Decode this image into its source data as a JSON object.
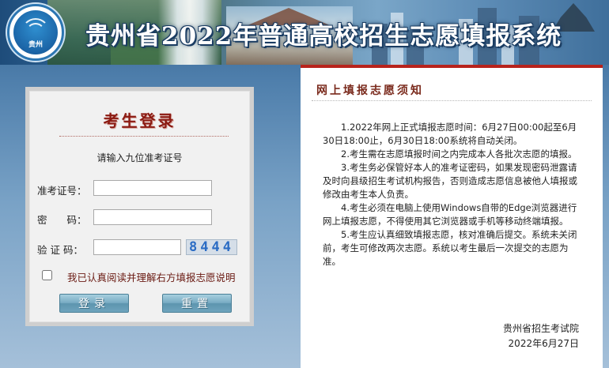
{
  "header": {
    "logo_text": "贵州",
    "title": "贵州省2022年普通高校招生志愿填报系统"
  },
  "login": {
    "title": "考生登录",
    "hint": "请输入九位准考证号",
    "fields": {
      "exam_id_label": "准考证号：",
      "exam_id_value": "",
      "password_label": "密　　码：",
      "password_value": "",
      "captcha_label": "验 证 码：",
      "captcha_value": "",
      "captcha_code": "8444"
    },
    "agree_label": "我已认真阅读并理解右方填报志愿说明",
    "agree_checked": false,
    "login_button": "登录",
    "reset_button": "重置"
  },
  "notice": {
    "title": "网上填报志愿须知",
    "items": [
      "1.2022年网上正式填报志愿时间：6月27日00:00起至6月30日18:00止，6月30日18:00系统将自动关闭。",
      "2.考生需在志愿填报时间之内完成本人各批次志愿的填报。",
      "3.考生务必保管好本人的准考证密码，如果发现密码泄露请及时向县级招生考试机构报告，否则造成志愿信息被他人填报或修改由考生本人负责。",
      "4.考生必须在电脑上使用Windows自带的Edge浏览器进行网上填报志愿，不得使用其它浏览器或手机等移动终端填报。",
      "5.考生应认真细致填报志愿，核对准确后提交。系统未关闭前，考生可修改两次志愿。系统以考生最后一次提交的志愿为准。"
    ],
    "issuer": "贵州省招生考试院",
    "date": "2022年6月27日"
  },
  "colors": {
    "accent_red": "#b8231c",
    "title_red": "#8b1a12",
    "button_blue": "#6ea4bd"
  }
}
